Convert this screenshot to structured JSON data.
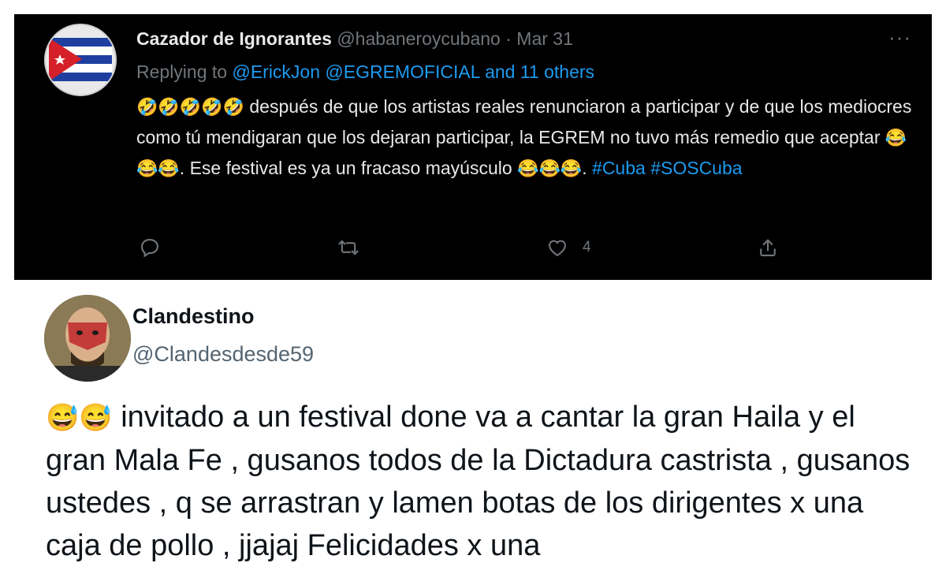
{
  "tweet1": {
    "display_name": "Cazador de Ignorantes",
    "handle": "@habaneroycubano",
    "separator": " · ",
    "date": "Mar 31",
    "more": "···",
    "replying_label": "Replying to ",
    "replying_to": "@ErickJon @EGREMOFICIAL and 11 others",
    "emoji_rofl": "🤣🤣🤣🤣🤣",
    "text_1": " después de que los artistas reales renunciaron a participar y de que los mediocres como tú mendigaran que los dejaran participar, la EGREM no tuvo más remedio que aceptar ",
    "emoji_joy_1": "😂😂😂",
    "text_2": ". Ese festival es ya un fracaso mayúsculo ",
    "emoji_joy_2": "😂😂😂",
    "text_3": ". ",
    "hashtag_1": "#Cuba",
    "hashtag_2": "#SOSCuba",
    "likes": "4",
    "icons": [
      "reply-icon",
      "retweet-icon",
      "like-icon",
      "share-icon"
    ]
  },
  "tweet2": {
    "display_name": "Clandestino",
    "handle": "@Clandesdesde59",
    "emoji": "😅😅",
    "text": " invitado a un festival done va a cantar la gran Haila y el gran Mala Fe , gusanos todos de la Dictadura castrista , gusanos ustedes , q se arrastran y lamen botas de los dirigentes x una caja de pollo , jjajaj Felicidades x una"
  },
  "colors": {
    "dark_bg": "#000000",
    "link_blue": "#1d9bf0",
    "dark_text": "#e7e9ea",
    "muted": "#71767b",
    "light_text": "#0f1419",
    "light_muted": "#536471"
  }
}
